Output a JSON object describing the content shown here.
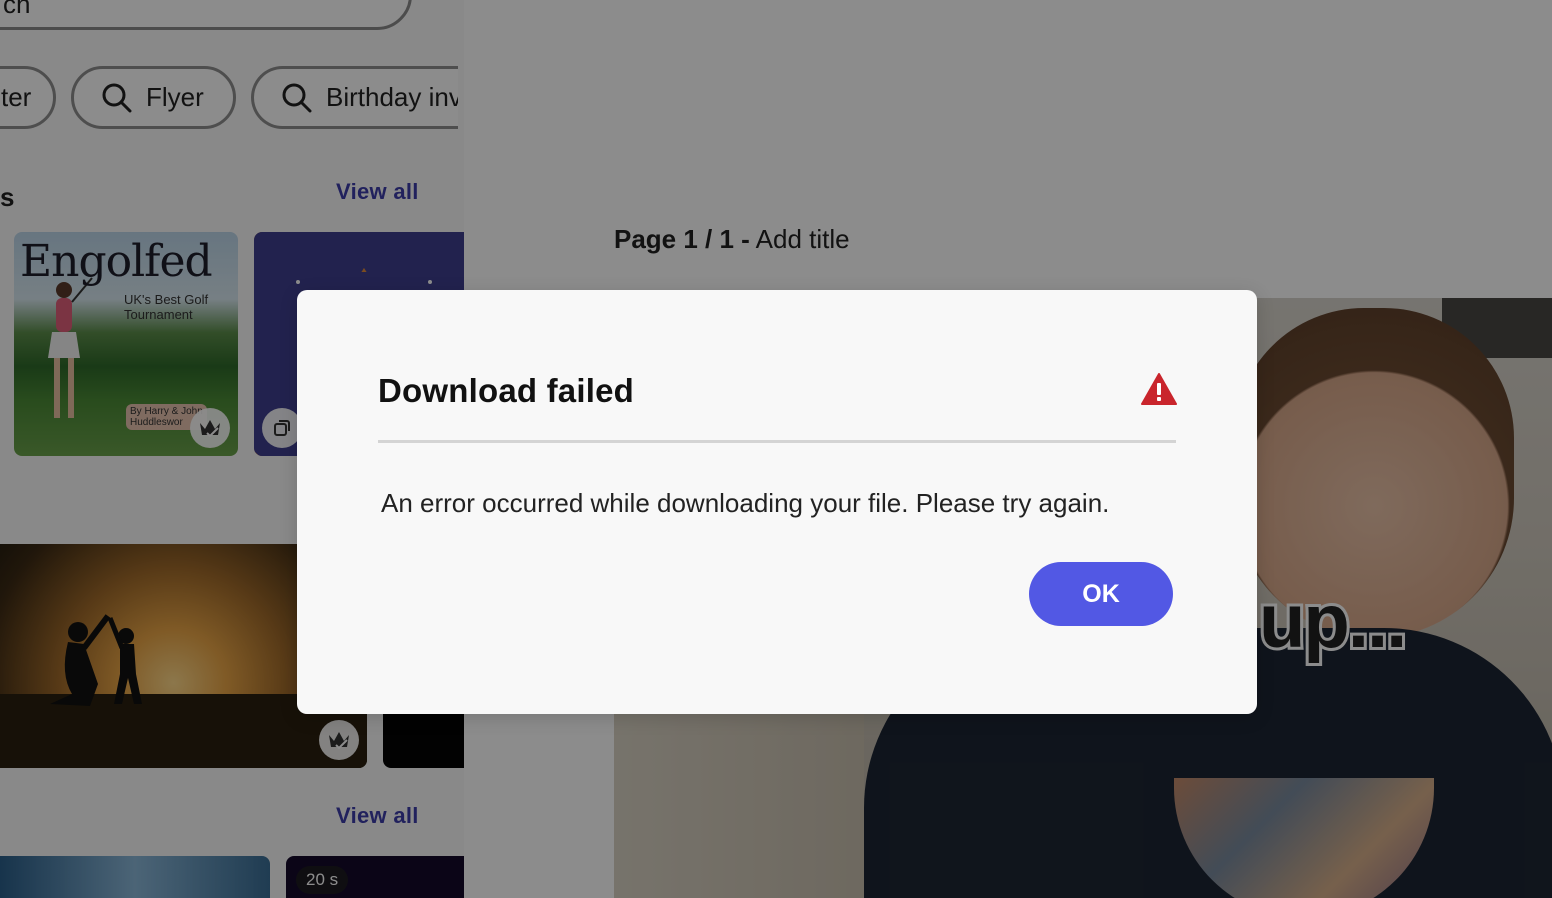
{
  "left_panel": {
    "search_text": "ch",
    "chips": [
      {
        "label": "ter"
      },
      {
        "label": "Flyer"
      },
      {
        "label": "Birthday inv"
      }
    ],
    "section1": {
      "heading": "s",
      "view_all": "View all"
    },
    "golf_card": {
      "title": "Engolfed",
      "subtitle": "UK's Best Golf\nTournament",
      "sign": "By Harry & John\nHuddleswor"
    },
    "section2": {
      "view_all": "View all"
    },
    "bottom_card": {
      "duration": "20 s"
    }
  },
  "canvas": {
    "page_label_bold": "Page 1 / 1 -",
    "page_label_title": "Add title",
    "video_caption": "up..."
  },
  "dialog": {
    "title": "Download failed",
    "message": "An error occurred while downloading your file. Please try again.",
    "ok_label": "OK",
    "icon": "alert-triangle-icon",
    "icon_color": "#c9252c",
    "button_color": "#5258e4"
  }
}
